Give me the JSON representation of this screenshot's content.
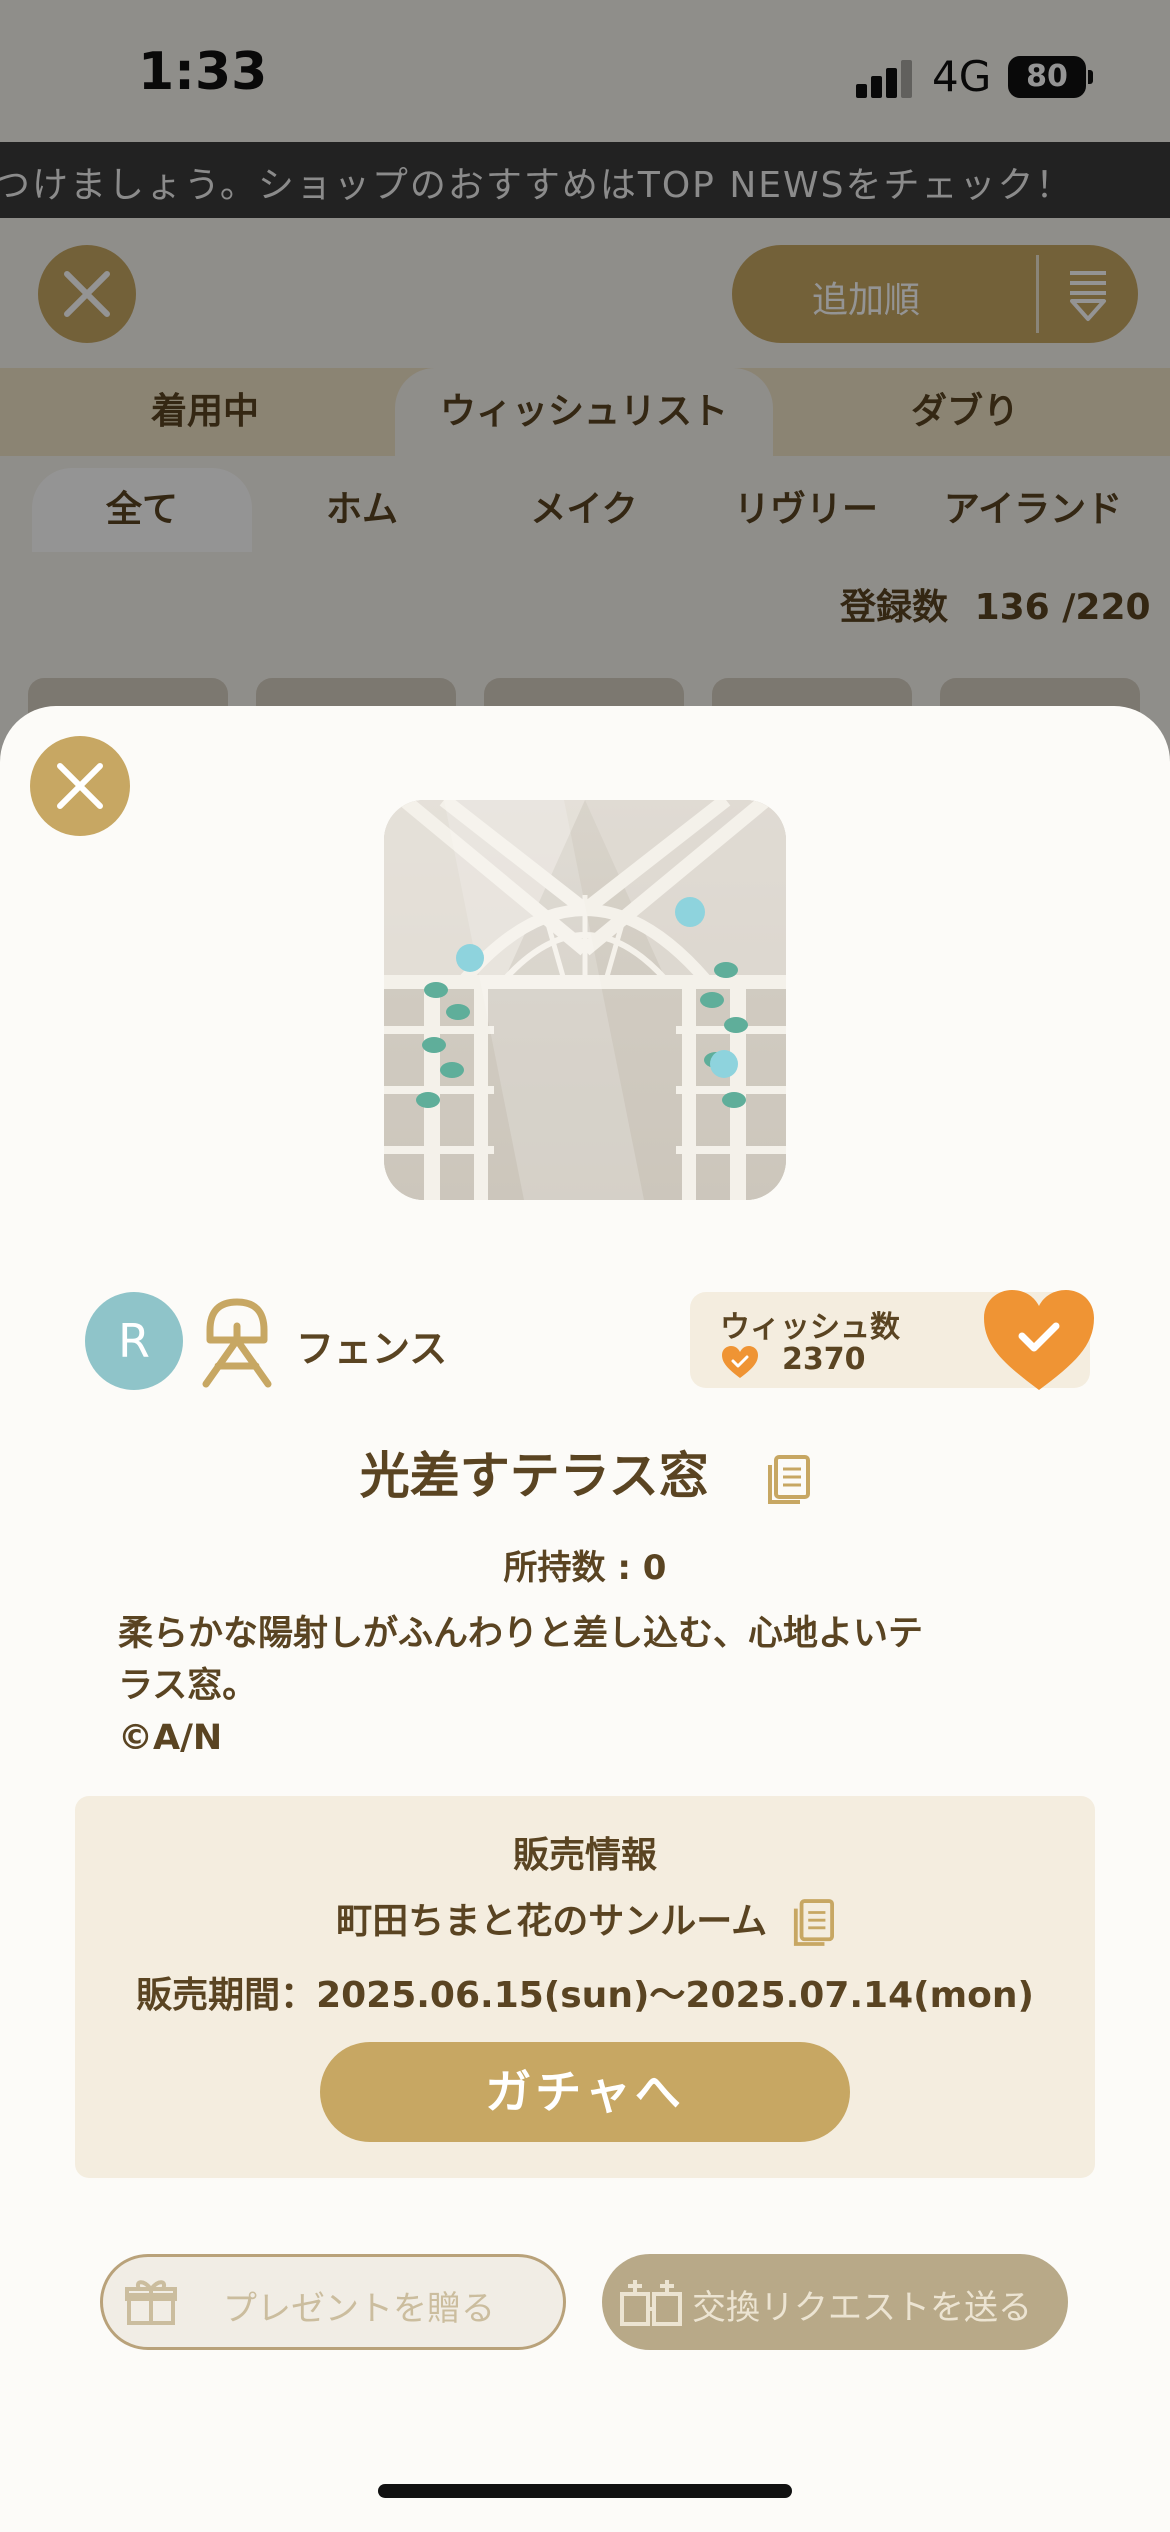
{
  "status_bar": {
    "time": "1:33",
    "network": "4G",
    "battery": "80"
  },
  "ticker": {
    "text": "つけましょう。ショップのおすすめはTOP NEWSをチェック！"
  },
  "header": {
    "sort_label": "追加順"
  },
  "tabs": [
    {
      "label": "着用中",
      "active": false
    },
    {
      "label": "ウィッシュリスト",
      "active": true
    },
    {
      "label": "ダブり",
      "active": false
    }
  ],
  "subtabs": [
    {
      "label": "全て",
      "active": true
    },
    {
      "label": "ホム",
      "active": false
    },
    {
      "label": "メイク",
      "active": false
    },
    {
      "label": "リヴリー",
      "active": false
    },
    {
      "label": "アイランド",
      "active": false
    }
  ],
  "registration": {
    "label": "登録数",
    "value": "136 /220"
  },
  "item": {
    "rarity": "R",
    "category": "フェンス",
    "name": "光差すテラス窓",
    "owned": "所持数 : 0",
    "description_line1": "柔らかな陽射しがふんわりと差し込む、心地よいテ",
    "description_line2": "ラス窓。",
    "copyright": "©A/N"
  },
  "wish": {
    "title": "ウィッシュ数",
    "count": "2370"
  },
  "sale": {
    "title": "販売情報",
    "name": "町田ちまと花のサンルーム",
    "period": "販売期間：2025.06.15(sun)〜2025.07.14(mon)",
    "button": "ガチャへ"
  },
  "actions": {
    "gift": "プレゼントを贈る",
    "trade": "交換リクエストを送る"
  },
  "colors": {
    "accent": "#c7a763",
    "wish_heart": "#ef9434",
    "rarity_badge": "#8fc4c9",
    "text": "#5a4422",
    "panel": "#f4eddf"
  }
}
